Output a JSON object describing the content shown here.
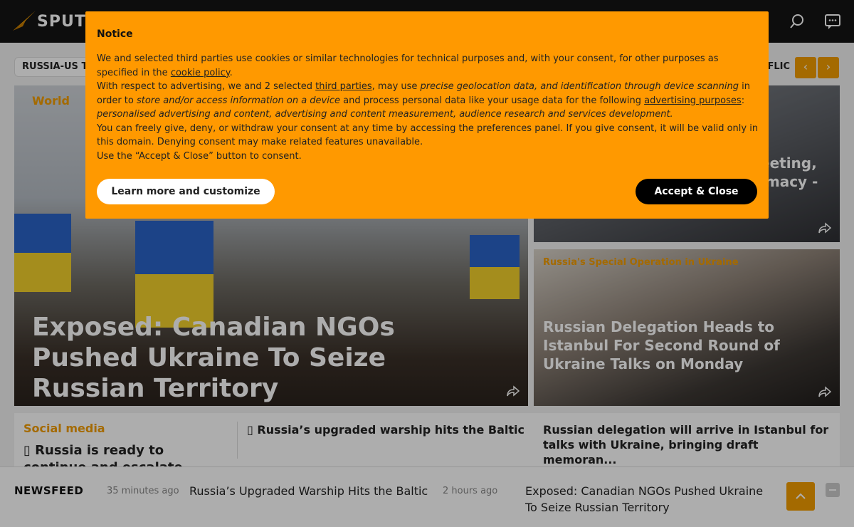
{
  "header": {
    "logo_text": "SPUTNIK",
    "accent": "#f29c00",
    "icons": [
      "search-icon",
      "chat-icon"
    ]
  },
  "tags": {
    "left": "RUSSIA-US TA",
    "right": "FLIC",
    "prev": "‹",
    "next": "›"
  },
  "main_story": {
    "category": "World",
    "title": "Exposed: Canadian NGOs Pushed Ukraine To Seize Russian Territory"
  },
  "side_story_1": {
    "title": "eeting, imacy -"
  },
  "side_story_2": {
    "category": "Russia's Special Operation in Ukraine",
    "title": "Russian Delegation Heads to Istanbul For Second Round of Ukraine Talks on Monday"
  },
  "teasers": {
    "col1_category": "Social media",
    "col1_title": "▯ Russia is ready to continue and escalate military",
    "col2_title": "▯ Russia’s upgraded warship hits the Baltic",
    "col3_title": "Russian delegation will arrive in Istanbul for talks with Ukraine, bringing draft memoran..."
  },
  "newsfeed": {
    "title": "NEWSFEED",
    "items": [
      {
        "time": "35 minutes ago",
        "title": "Russia’s Upgraded Warship Hits the Baltic"
      },
      {
        "time": "2 hours ago",
        "title": "Exposed: Canadian NGOs Pushed Ukraine To Seize Russian Territory"
      }
    ]
  },
  "notice": {
    "title": "Notice",
    "p1_a": "We and selected third parties use cookies or similar technologies for technical purposes and, with your consent, for other purposes as specified in the ",
    "p1_link": "cookie policy",
    "p1_b": ".",
    "p2_a": "With respect to advertising, we and 2 selected ",
    "p2_link1": "third parties",
    "p2_b": ", may use ",
    "p2_i1": "precise geolocation data, and identification through device scanning",
    "p2_c": " in order to ",
    "p2_i2": "store and/or access information on a device",
    "p2_d": " and process personal data like your usage data for the following ",
    "p2_link2": "advertising purposes",
    "p2_e": ": ",
    "p2_i3": "personalised advertising and content, advertising and content measurement, audience research and services development.",
    "p3": "You can freely give, deny, or withdraw your consent at any time by accessing the preferences panel. If you give consent, it will be valid only in this domain. Denying consent may make related features unavailable.",
    "p4": "Use the “Accept & Close” button to consent.",
    "learn_button": "Learn more and customize",
    "accept_button": "Accept & Close"
  }
}
